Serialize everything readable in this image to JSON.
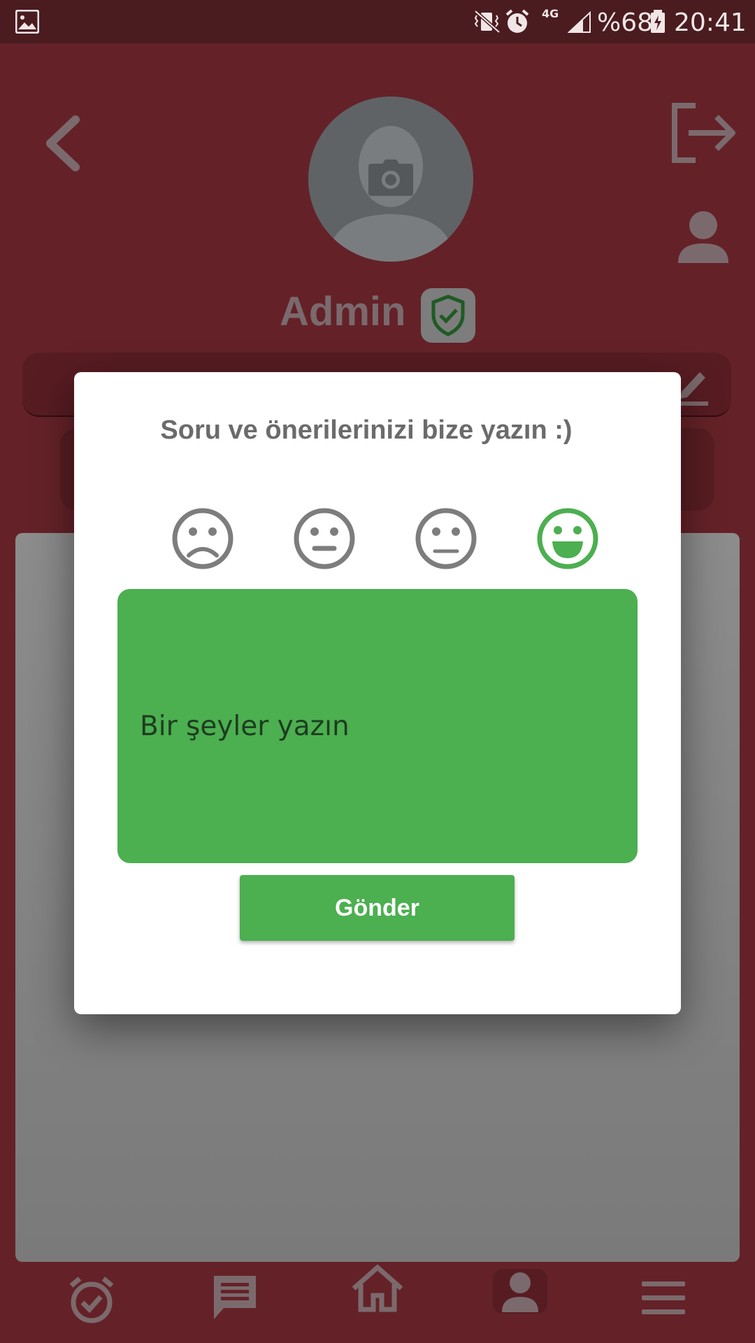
{
  "status_bar": {
    "battery_percent": "%68",
    "time": "20:41",
    "network": "4G",
    "icons": [
      "gallery-icon",
      "vibrate-mute-icon",
      "alarm-icon",
      "signal-icon",
      "battery-icon"
    ]
  },
  "profile": {
    "username": "Admin",
    "verified_icon": "shield-check-icon"
  },
  "dialog": {
    "title": "Soru ve önerilerinizi bize yazın :)",
    "ratings": [
      {
        "name": "sad-face-icon",
        "selected": false
      },
      {
        "name": "neutral-face-icon",
        "selected": false
      },
      {
        "name": "meh-face-icon",
        "selected": false
      },
      {
        "name": "happy-face-icon",
        "selected": true
      }
    ],
    "message_placeholder": "Bir şeyler yazın",
    "send_label": "Gönder"
  },
  "bottom_nav": [
    "alarm-check-icon",
    "chat-icon",
    "home-icon",
    "profile-icon",
    "menu-icon"
  ],
  "colors": {
    "primary": "#642228",
    "accent_green": "#4caf50",
    "dialog_bg": "#ffffff"
  }
}
